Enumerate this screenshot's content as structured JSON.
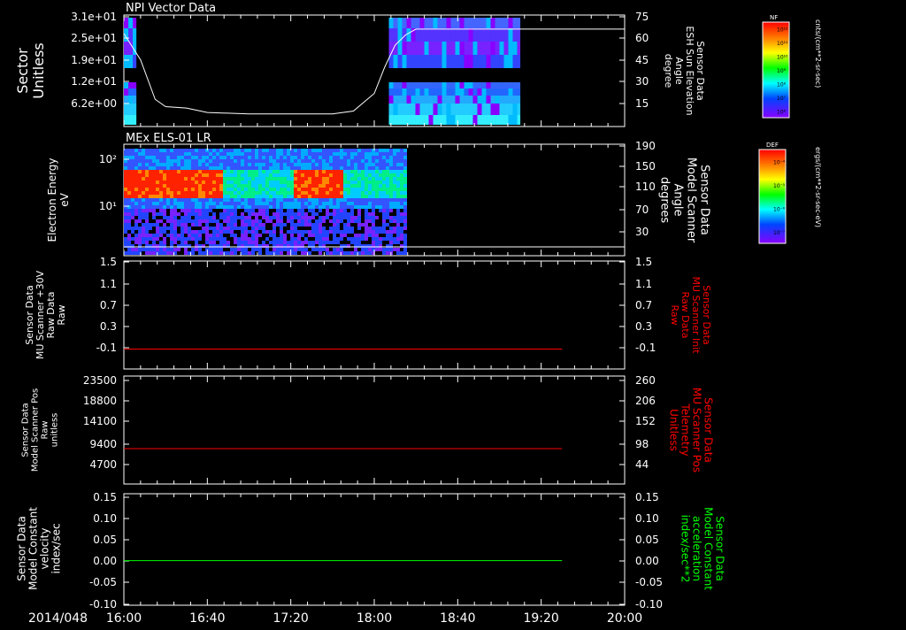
{
  "date_label": "2014/048",
  "time_ticks": [
    "16:00",
    "16:40",
    "17:20",
    "18:00",
    "18:40",
    "19:20",
    "20:00"
  ],
  "colors": {
    "white": "#ffffff",
    "red": "#ff0000",
    "green": "#00ff00",
    "panel_bg": "#000000"
  },
  "colorbars": [
    {
      "label": "NF",
      "units": "cnts/(cm**2-sr-sec)",
      "ticks": [
        "10¹²",
        "10¹¹",
        "10¹⁰",
        "10⁹",
        "10⁸",
        "10⁷",
        "10⁶"
      ]
    },
    {
      "label": "DEF",
      "units": "ergs/(cm**2-sr-sec-eV)",
      "ticks": [
        "10⁻⁴",
        "10⁻⁵",
        "10⁻⁶",
        "10⁻⁷"
      ]
    }
  ],
  "chart_data": [
    {
      "type": "heatmap",
      "title": "NPI Vector Data",
      "ylabel": [
        "Sector",
        "Unitless"
      ],
      "y_ticks": [
        "3.1e+01",
        "2.5e+01",
        "1.9e+01",
        "1.2e+01",
        "6.2e+00"
      ],
      "right_ylabel": [
        "Sensor Data",
        "ESH Sun Elevation",
        "Angle",
        "degree"
      ],
      "right_ticks": [
        "75",
        "60",
        "45",
        "30",
        "15"
      ],
      "right_ylim": [
        0,
        75
      ],
      "line_series": {
        "name": "ESH Sun Elevation Angle",
        "x": [
          "16:00",
          "16:08",
          "16:15",
          "16:20",
          "16:30",
          "16:40",
          "17:00",
          "17:20",
          "17:40",
          "17:50",
          "18:00",
          "18:05",
          "18:10",
          "18:15",
          "18:20",
          "18:30",
          "19:00",
          "19:30",
          "20:00"
        ],
        "values": [
          63,
          45,
          18,
          13,
          12,
          9,
          8,
          8,
          8,
          10,
          22,
          40,
          55,
          62,
          66,
          66,
          66,
          66,
          66
        ]
      },
      "data_blocks": [
        {
          "x_start": "16:00",
          "x_end": "16:06",
          "description": "blue/purple counts"
        },
        {
          "x_start": "18:07",
          "x_end": "19:10",
          "description": "blue/purple counts"
        }
      ]
    },
    {
      "type": "heatmap",
      "title": "MEx ELS-01 LR",
      "ylabel": [
        "Electron Energy",
        "eV"
      ],
      "y_ticks": [
        "10²",
        "10¹"
      ],
      "right_ylabel": [
        "Sensor Data",
        "Model Scanner",
        "Angle",
        "degrees"
      ],
      "right_ticks": [
        "190",
        "150",
        "110",
        "70",
        "30"
      ],
      "right_ylim": [
        0,
        190
      ],
      "line_series": {
        "name": "Model Scanner Angle",
        "x": [
          "16:00",
          "20:00"
        ],
        "values": [
          12,
          12
        ]
      },
      "data_blocks": [
        {
          "x_start": "16:00",
          "x_end": "18:15",
          "description": "electron energy spectrogram"
        }
      ]
    },
    {
      "type": "line",
      "ylabel": [
        "Sensor Data",
        "MU Scanner +30V",
        "Raw Data",
        "Raw"
      ],
      "y_ticks": [
        "1.5",
        "1.1",
        "0.7",
        "0.3",
        "-0.1"
      ],
      "ylim": [
        -0.4,
        1.5
      ],
      "right_ylabel": [
        "Sensor Data",
        "MU Scanner Init",
        "Raw Data",
        "Raw"
      ],
      "right_ticks": [
        "1.5",
        "1.1",
        "0.7",
        "0.3",
        "-0.1"
      ],
      "series": [
        {
          "x": [
            "16:00",
            "19:30"
          ],
          "values": [
            -0.05,
            -0.05
          ]
        }
      ]
    },
    {
      "type": "line",
      "ylabel": [
        "Sensor Data",
        "Model Scanner Pos",
        "Raw",
        "unitless"
      ],
      "y_ticks": [
        "23500",
        "18800",
        "14100",
        "9400",
        "4700"
      ],
      "ylim": [
        0,
        23500
      ],
      "right_ylabel": [
        "Sensor Data",
        "MU Scanner Pos",
        "Telemetry",
        "Unitless"
      ],
      "right_ticks": [
        "260",
        "206",
        "152",
        "98",
        "44"
      ],
      "series": [
        {
          "x": [
            "16:00",
            "19:30"
          ],
          "values": [
            7700,
            7700
          ]
        }
      ]
    },
    {
      "type": "line",
      "ylabel": [
        "Sensor Data",
        "Model Constant",
        "velocity",
        "index/sec"
      ],
      "y_ticks": [
        "0.15",
        "0.10",
        "0.05",
        "0.00",
        "-0.05",
        "-0.10"
      ],
      "ylim": [
        -0.1,
        0.15
      ],
      "right_ylabel": [
        "Sensor Data",
        "Model Constant",
        "acceleration",
        "index/sec**2"
      ],
      "right_ticks": [
        "0.15",
        "0.10",
        "0.05",
        "0.00",
        "-0.05",
        "-0.10"
      ],
      "series": [
        {
          "x": [
            "16:00",
            "19:30"
          ],
          "values": [
            0.0,
            0.0
          ]
        }
      ]
    }
  ]
}
